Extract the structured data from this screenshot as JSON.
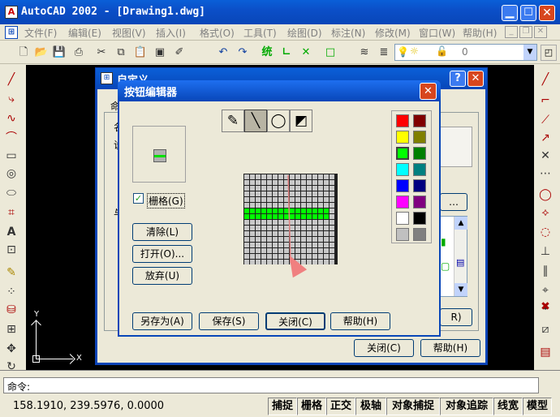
{
  "window": {
    "title": "AutoCAD 2002 - [Drawing1.dwg]"
  },
  "menu": [
    "文件(F)",
    "编辑(E)",
    "视图(V)",
    "插入(I)",
    "格式(O)",
    "工具(T)",
    "绘图(D)",
    "标注(N)",
    "修改(M)",
    "窗口(W)",
    "帮助(H)"
  ],
  "toolbar": {
    "layer_value": "0"
  },
  "custom_dialog": {
    "title": "自定义",
    "tab_fragment": "命",
    "left_frag1": "名",
    "left_frag2": "说",
    "left_frag3": "与",
    "right_btn_frag": "…",
    "right_btn_frag2": "R)",
    "close_label": "关闭(C)",
    "help_label": "帮助(H)"
  },
  "editor": {
    "title": "按钮编辑器",
    "grid_label": "栅格(G)",
    "grid_checked": true,
    "clear_label": "清除(L)",
    "open_label": "打开(O)...",
    "discard_label": "放弃(U)",
    "saveas_label": "另存为(A)",
    "save_label": "保存(S)",
    "close_label": "关闭(C)",
    "help_label": "帮助(H)"
  },
  "palette": [
    "#FF0000",
    "#800000",
    "#FFFF00",
    "#808000",
    "#00FF00",
    "#008000",
    "#00FFFF",
    "#008080",
    "#0000FF",
    "#000080",
    "#FF00FF",
    "#800080",
    "#FFFFFF",
    "#000000",
    "#C0C0C0",
    "#808080"
  ],
  "command": {
    "label": "命令:"
  },
  "status": {
    "coords": "158.1910, 239.5976, 0.0000",
    "buttons": [
      "捕捉",
      "栅格",
      "正交",
      "极轴",
      "对象捕捉",
      "对象追踪",
      "线宽",
      "模型"
    ]
  },
  "ucs": {
    "y": "Y",
    "x": "X"
  }
}
